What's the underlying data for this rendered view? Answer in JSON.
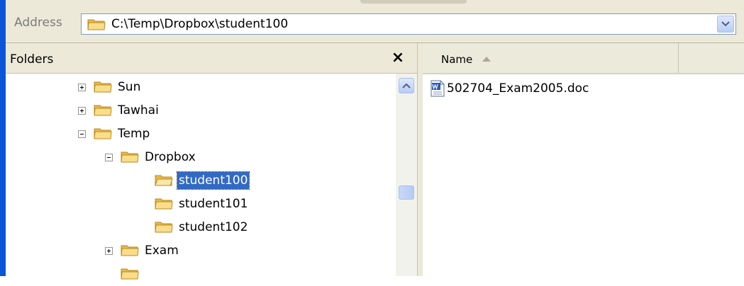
{
  "address_bar": {
    "label": "Address",
    "path": "C:\\Temp\\Dropbox\\student100"
  },
  "folders_pane": {
    "title": "Folders",
    "close_glyph": "×",
    "tree": [
      {
        "label": "Sun",
        "expander": "plus"
      },
      {
        "label": "Tawhai",
        "expander": "plus"
      },
      {
        "label": "Temp",
        "expander": "minus"
      },
      {
        "label": "Dropbox",
        "expander": "minus"
      },
      {
        "label": "student100",
        "selected": true
      },
      {
        "label": "student101"
      },
      {
        "label": "student102"
      },
      {
        "label": "Exam",
        "expander": "plus"
      }
    ]
  },
  "file_list": {
    "columns": [
      {
        "label": "Name",
        "sort": "ascending"
      }
    ],
    "items": [
      {
        "name": "502704_Exam2005.doc",
        "icon": "word-document-icon"
      }
    ]
  },
  "colors": {
    "accent": "#316ac5",
    "folder_fill": "#f6d77a",
    "chrome": "#ece9d8",
    "window_border": "#0a55d8"
  },
  "icons": {
    "folder": "folder-icon",
    "dropdown": "chevron-down-icon",
    "close": "close-icon",
    "scroll_up": "chevron-up-icon",
    "sort": "sort-ascending-icon"
  }
}
